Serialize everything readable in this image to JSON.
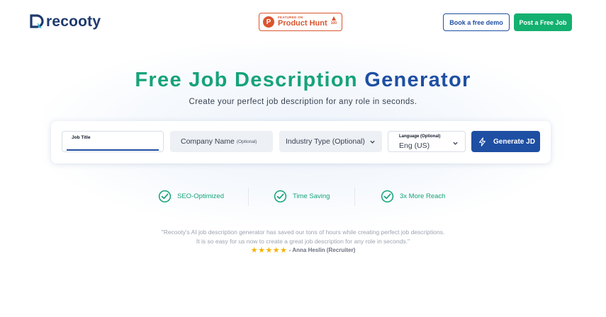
{
  "header": {
    "logo_text": "recooty",
    "product_hunt": {
      "featured_label": "FEATURED ON",
      "name": "Product Hunt",
      "votes": "100",
      "color": "#da552f"
    },
    "demo_button": "Book a free demo",
    "post_button": "Post a Free Job"
  },
  "hero": {
    "title_part1": "Free Job Description",
    "title_part2": "Generator",
    "subtitle": "Create your perfect job description for any role in seconds."
  },
  "form": {
    "job_title_label": "Job Title",
    "job_title_value": "",
    "company_placeholder": "Company Name",
    "company_optional": "(Optional)",
    "industry_placeholder": "Industry Type (Optional)",
    "language_label": "Language (Optional)",
    "language_value": "Eng (US)",
    "generate_button": "Generate JD"
  },
  "features": [
    {
      "label": "SEO-Optimized",
      "icon": "check-circle-icon"
    },
    {
      "label": "Time Saving",
      "icon": "check-circle-icon"
    },
    {
      "label": "3x More Reach",
      "icon": "check-circle-icon"
    }
  ],
  "testimonial": {
    "line1": "\"Recooty's AI job description generator has saved our tons of hours while creating perfect job descriptions.",
    "line2": "It is so easy for us now to create a great job description for any role in seconds.\"",
    "stars": "★★★★★",
    "author": "- Anna Heslin (Recruiter)"
  },
  "colors": {
    "brand_green": "#16a37a",
    "brand_blue": "#1e4fa3",
    "button_green": "#13b06f",
    "star": "#f5b301"
  }
}
